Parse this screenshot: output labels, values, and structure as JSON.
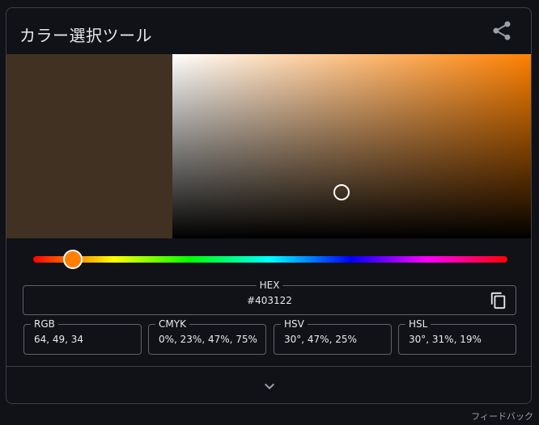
{
  "widget": {
    "title": "カラー選択ツール"
  },
  "color": {
    "selected_hex_color": "#403122",
    "hue_color": "#ff8000",
    "hue_degrees": 30,
    "saturation_fraction": 0.47,
    "value_fraction": 0.25
  },
  "fields": {
    "hex": {
      "label": "HEX",
      "value": "#403122"
    },
    "rgb": {
      "label": "RGB",
      "value": "64, 49, 34"
    },
    "cmyk": {
      "label": "CMYK",
      "value": "0%, 23%, 47%, 75%"
    },
    "hsv": {
      "label": "HSV",
      "value": "30°, 47%, 25%"
    },
    "hsl": {
      "label": "HSL",
      "value": "30°, 31%, 19%"
    }
  },
  "icons": {
    "share": "share-icon",
    "copy": "copy-icon",
    "expand": "chevron-down-icon"
  },
  "footer": {
    "feedback_label": "フィードバック"
  }
}
